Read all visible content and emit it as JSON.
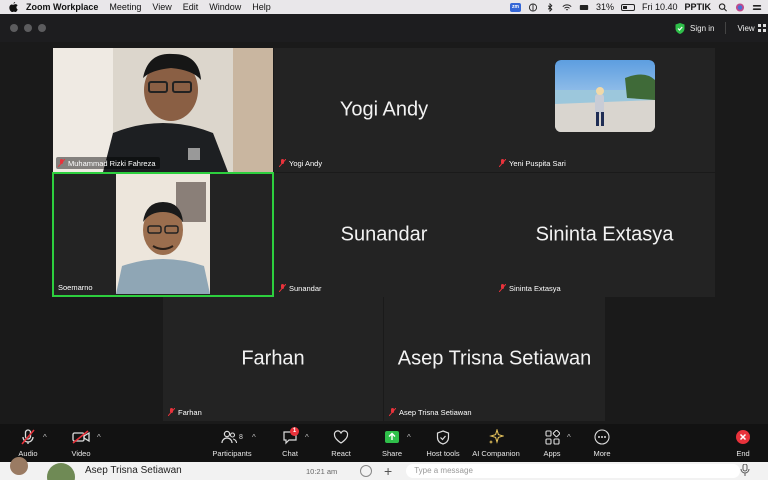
{
  "menubar": {
    "app_name": "Zoom Workplace",
    "items": [
      "Meeting",
      "View",
      "Edit",
      "Window",
      "Help"
    ],
    "battery": "31%",
    "clock": "Fri 10.40",
    "user": "PPTIK",
    "zoom_badge": "zm"
  },
  "titlebar": {
    "signin_label": "Sign in",
    "view_label": "View"
  },
  "participants": [
    {
      "name": "Muhammad Rizki Fahreza",
      "video": true
    },
    {
      "name": "Yogi Andy",
      "video": false
    },
    {
      "name": "Yeni Puspita Sari",
      "video": true
    },
    {
      "name": "Soemarno",
      "video": true,
      "active_speaker": true
    },
    {
      "name": "Sunandar",
      "video": false
    },
    {
      "name": "Sininta Extasya",
      "video": false
    },
    {
      "name": "Farhan",
      "video": false
    },
    {
      "name": "Asep Trisna Setiawan",
      "video": false
    }
  ],
  "toolbar": {
    "audio": "Audio",
    "video": "Video",
    "participants": "Participants",
    "participants_count": "8",
    "chat": "Chat",
    "chat_badge": "1",
    "react": "React",
    "share": "Share",
    "host_tools": "Host tools",
    "ai_companion": "AI Companion",
    "apps": "Apps",
    "more": "More",
    "end": "End"
  },
  "chat_strip": {
    "contact_name": "Asep Trisna Setiawan",
    "time": "10:21 am",
    "message_placeholder": "Type a message"
  },
  "colors": {
    "active_speaker_border": "#2dcf3e",
    "muted_red": "#e8323b",
    "share_green": "#2fbf4a",
    "end_red": "#e8323b"
  }
}
